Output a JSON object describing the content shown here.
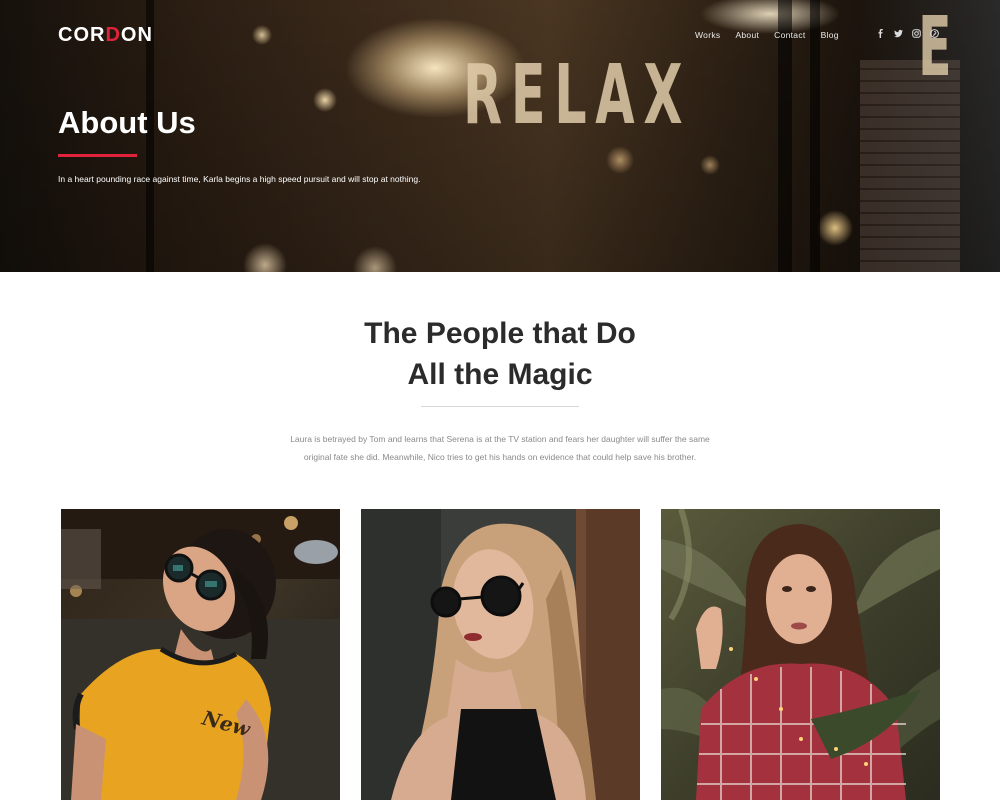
{
  "brand": {
    "logo_text_1": "COR",
    "logo_text_accent": "D",
    "logo_text_2": "ON"
  },
  "nav": {
    "items": [
      "Works",
      "About",
      "Contact",
      "Blog"
    ]
  },
  "social": [
    "facebook-icon",
    "twitter-icon",
    "instagram-icon",
    "pinterest-icon"
  ],
  "hero": {
    "title": "About Us",
    "subtitle": "In a heart pounding race against time, Karla begins a high speed pursuit and will stop at nothing.",
    "sign_text": "RELAX",
    "sign_partial": "E"
  },
  "section": {
    "title_line1": "The People that Do",
    "title_line2": "All the Magic",
    "text": "Laura is betrayed by Tom and learns that Serena is at the TV station and fears her daughter will suffer the same original fate she did. Meanwhile, Nico tries to get his hands on evidence that could help save his brother.",
    "shirt_text": "New"
  },
  "colors": {
    "accent": "#e0223b",
    "heading": "#2b2b2b",
    "muted": "#8a8a8a"
  }
}
